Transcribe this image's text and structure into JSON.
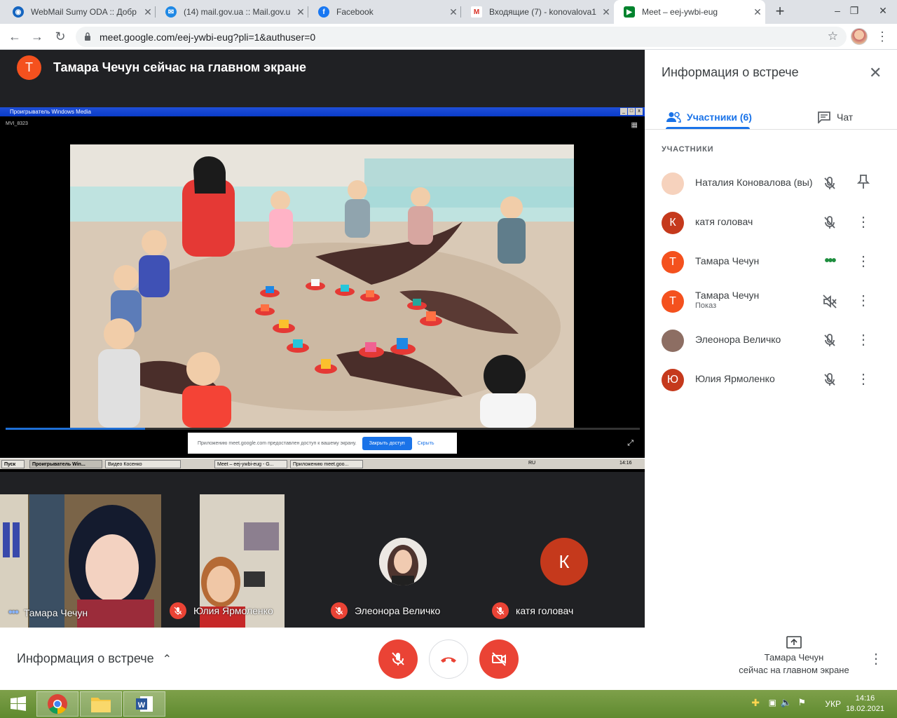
{
  "browser": {
    "tabs": [
      {
        "title": "WebMail Sumy ODA :: Добр",
        "icon": "globe-icon"
      },
      {
        "title": "(14) mail.gov.ua :: Mail.gov.u",
        "icon": "mail-icon"
      },
      {
        "title": "Facebook",
        "icon": "facebook-icon"
      },
      {
        "title": "Входящие (7) - konovalova1",
        "icon": "gmail-icon"
      },
      {
        "title": "Meet – eej-ywbi-eug",
        "icon": "meet-icon"
      }
    ],
    "url": "meet.google.com/eej-ywbi-eug?pli=1&authuser=0"
  },
  "stage": {
    "presenter_initial": "Т",
    "presenter_text": "Тамара Чечун сейчас на главном экране"
  },
  "shared_screen": {
    "window_title": "Проигрыватель Windows Media",
    "file_name": "MVI_8323",
    "progress": 0.22,
    "notice_text": "Приложению meet.google.com предоставлен доступ к вашему экрану.",
    "notice_stop": "Закрыть доступ",
    "notice_hide": "Скрыть",
    "taskbar": {
      "start": "Пуск",
      "items": [
        "Проигрыватель Win...",
        "Видео Косенко",
        "Meet – eej-ywbi-eug - G...",
        "Приложению meet.goo..."
      ],
      "lang": "RU",
      "time": "14:16"
    }
  },
  "tiles": [
    {
      "name": "Тамара Чечун",
      "status": "speaking"
    },
    {
      "name": "Юлия Ярмоленко",
      "status": "muted"
    },
    {
      "name": "Элеонора Величко",
      "status": "muted"
    },
    {
      "name": "катя головач",
      "status": "muted",
      "initial": "К"
    }
  ],
  "panel": {
    "title": "Информация о встрече",
    "tab_participants": "Участники (6)",
    "tab_chat": "Чат",
    "section_label": "УЧАСТНИКИ",
    "participants": [
      {
        "name": "Наталия Коновалова (вы)",
        "initial": "",
        "color": "#f6d2bd",
        "status": "muted",
        "action": "pin-icon"
      },
      {
        "name": "катя головач",
        "initial": "К",
        "color": "#c5391c",
        "status": "muted",
        "action": "more-icon"
      },
      {
        "name": "Тамара Чечун",
        "initial": "Т",
        "color": "#f4511e",
        "status": "speaking",
        "action": "more-icon"
      },
      {
        "name": "Тамара Чечун",
        "sub": "Показ",
        "initial": "Т",
        "color": "#f4511e",
        "status": "volume-off",
        "action": "more-icon"
      },
      {
        "name": "Элеонора Величко",
        "initial": "",
        "color": "#8d6e63",
        "status": "muted",
        "action": "more-icon"
      },
      {
        "name": "Юлия Ярмоленко",
        "initial": "Ю",
        "color": "#c5391c",
        "status": "muted",
        "action": "more-icon"
      }
    ]
  },
  "controls": {
    "meeting_info": "Информация о встрече",
    "present_line1": "Тамара Чечун",
    "present_line2": "сейчас на главном экране"
  },
  "windows": {
    "lang": "УКР",
    "time": "14:16",
    "date": "18.02.2021"
  },
  "colors": {
    "accent": "#1a73e8",
    "danger": "#ea4335",
    "meet_bg": "#202124"
  }
}
